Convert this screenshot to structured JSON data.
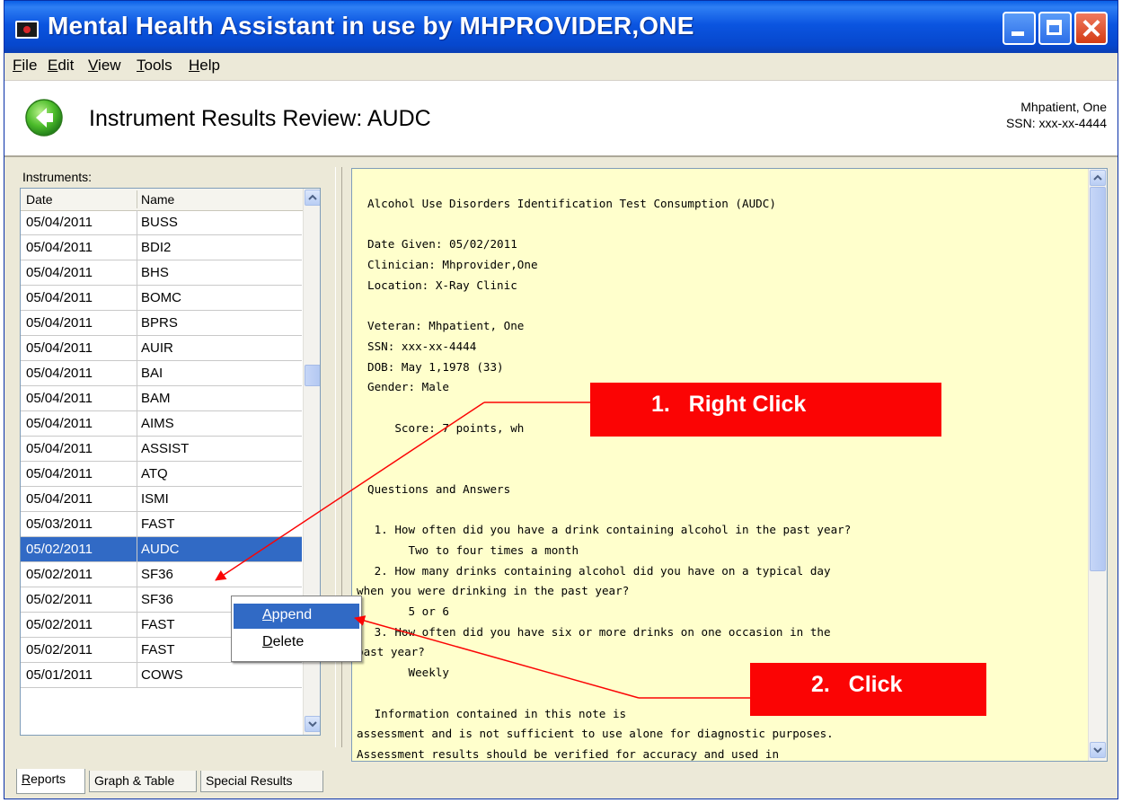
{
  "window": {
    "title": "Mental Health Assistant in use by MHPROVIDER,ONE",
    "controls": [
      "minimize-icon",
      "maximize-icon",
      "close-icon"
    ]
  },
  "menu": [
    {
      "accel": "F",
      "rest": "ile"
    },
    {
      "accel": "E",
      "rest": "dit"
    },
    {
      "accel": "V",
      "rest": "iew"
    },
    {
      "accel": "T",
      "rest": "ools"
    },
    {
      "accel": "H",
      "rest": "elp"
    }
  ],
  "header": {
    "title": "Instrument Results Review: AUDC",
    "patient_name": "Mhpatient, One",
    "patient_ssn": "SSN: xxx-xx-4444",
    "back_icon": "back-arrow-icon"
  },
  "instruments": {
    "label": "Instruments:",
    "columns": [
      "Date",
      "Name"
    ],
    "rows": [
      {
        "date": "05/04/2011",
        "name": "BUSS"
      },
      {
        "date": "05/04/2011",
        "name": "BDI2"
      },
      {
        "date": "05/04/2011",
        "name": "BHS"
      },
      {
        "date": "05/04/2011",
        "name": "BOMC"
      },
      {
        "date": "05/04/2011",
        "name": "BPRS"
      },
      {
        "date": "05/04/2011",
        "name": "AUIR"
      },
      {
        "date": "05/04/2011",
        "name": "BAI"
      },
      {
        "date": "05/04/2011",
        "name": "BAM"
      },
      {
        "date": "05/04/2011",
        "name": "AIMS"
      },
      {
        "date": "05/04/2011",
        "name": "ASSIST"
      },
      {
        "date": "05/04/2011",
        "name": "ATQ"
      },
      {
        "date": "05/04/2011",
        "name": "ISMI"
      },
      {
        "date": "05/03/2011",
        "name": "FAST"
      },
      {
        "date": "05/02/2011",
        "name": "AUDC"
      },
      {
        "date": "05/02/2011",
        "name": "SF36"
      },
      {
        "date": "05/02/2011",
        "name": "SF36"
      },
      {
        "date": "05/02/2011",
        "name": "FAST"
      },
      {
        "date": "05/02/2011",
        "name": "FAST"
      },
      {
        "date": "05/01/2011",
        "name": "COWS"
      }
    ],
    "selected_index": 13
  },
  "report": {
    "lines": [
      {
        "text": "Alcohol Use Disorders Identification Test Consumption (AUDC)",
        "indent": 1
      },
      {
        "text": "",
        "indent": 0
      },
      {
        "text": "Date Given: 05/02/2011",
        "indent": 1
      },
      {
        "text": "Clinician: Mhprovider,One",
        "indent": 1
      },
      {
        "text": "Location: X-Ray Clinic",
        "indent": 1
      },
      {
        "text": "",
        "indent": 0
      },
      {
        "text": "Veteran: Mhpatient, One",
        "indent": 1
      },
      {
        "text": "SSN: xxx-xx-4444",
        "indent": 1
      },
      {
        "text": "DOB: May 1,1978 (33)",
        "indent": 1
      },
      {
        "text": "Gender: Male",
        "indent": 1
      },
      {
        "text": "",
        "indent": 0
      },
      {
        "text": "    Score: 7 points, wh",
        "indent": 1
      },
      {
        "text": "",
        "indent": 0
      },
      {
        "text": "",
        "indent": 0
      },
      {
        "text": "Questions and Answers",
        "indent": 1
      },
      {
        "text": "",
        "indent": 0
      },
      {
        "text": " 1. How often did you have a drink containing alcohol in the past year?",
        "indent": 1
      },
      {
        "text": "      Two to four times a month",
        "indent": 1
      },
      {
        "text": " 2. How many drinks containing alcohol did you have on a typical day",
        "indent": 1
      },
      {
        "text": "when you were drinking in the past year?",
        "indent": 0
      },
      {
        "text": "      5 or 6",
        "indent": 1
      },
      {
        "text": " 3. How often did you have six or more drinks on one occasion in the",
        "indent": 1
      },
      {
        "text": "past year?",
        "indent": 0
      },
      {
        "text": "      Weekly",
        "indent": 1
      },
      {
        "text": "",
        "indent": 0
      },
      {
        "text": " Information contained in this note is",
        "indent": 1
      },
      {
        "text": "assessment and is not sufficient to use alone for diagnostic purposes.",
        "indent": 0
      },
      {
        "text": "Assessment results should be verified for accuracy and used in",
        "indent": 0
      }
    ]
  },
  "context_menu": {
    "items": [
      {
        "accel": "A",
        "rest": "ppend"
      },
      {
        "accel": "D",
        "rest": "elete"
      }
    ],
    "hover_index": 0
  },
  "callouts": {
    "first": "1.   Right Click",
    "second": "2.   Click",
    "color": "#fb0404"
  },
  "tabs": [
    {
      "accel": "R",
      "rest": "eports"
    },
    {
      "accel": "",
      "rest": "Graph & Table"
    },
    {
      "accel": "",
      "rest": "Special Results"
    }
  ],
  "colors": {
    "titlebar": "#0a57dc",
    "selection": "#316ac5",
    "report_background": "#ffffcc",
    "window_face": "#ece9d8"
  }
}
